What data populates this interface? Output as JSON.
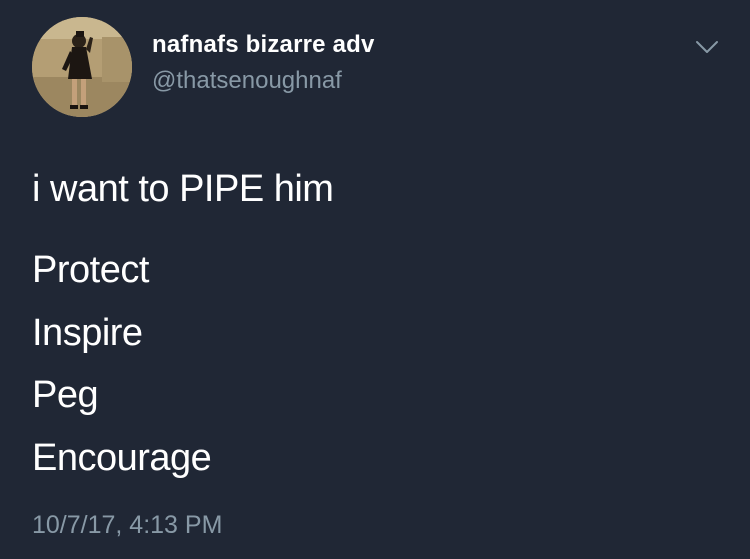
{
  "user": {
    "display_name": "nafnafs bizarre adv",
    "handle": "@thatsenoughnaf",
    "avatar_icon": "profile-photo"
  },
  "menu": {
    "icon": "chevron-down-icon"
  },
  "tweet": {
    "lines": [
      "i want to PIPE him",
      "Protect",
      "Inspire",
      "Peg",
      "Encourage"
    ],
    "timestamp": "10/7/17, 4:13 PM"
  },
  "colors": {
    "background": "#202735",
    "text": "#ffffff",
    "secondary_text": "#8899a6"
  }
}
